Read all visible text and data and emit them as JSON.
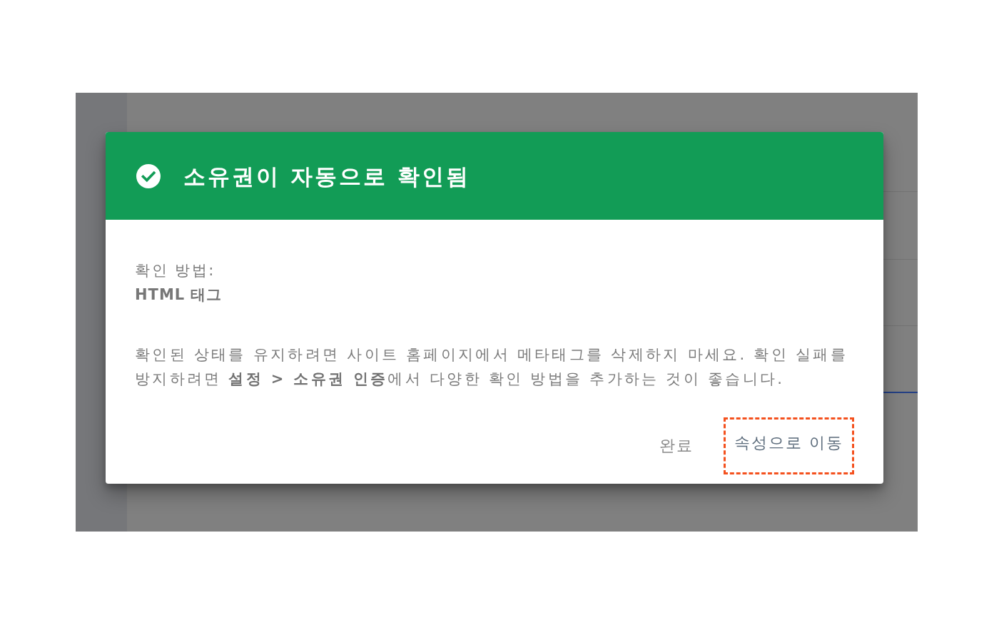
{
  "dialog": {
    "title": "소유권이 자동으로 확인됨",
    "method_label": "확인 방법:",
    "method_value": "HTML 태그",
    "message": "확인된 상태를 유지하려면 사이트 홈페이지에서 메타태그를 삭제하지 마세요. 확인 실패를 방지하려면 **설정 > 소유권 인증**에서 다양한 확인 방법을 추가하는 것이 좋습니다.",
    "actions": [
      {
        "label": "완료",
        "kind": "secondary",
        "highlighted": false
      },
      {
        "label": "속성으로 이동",
        "kind": "primary",
        "highlighted": true
      }
    ]
  }
}
